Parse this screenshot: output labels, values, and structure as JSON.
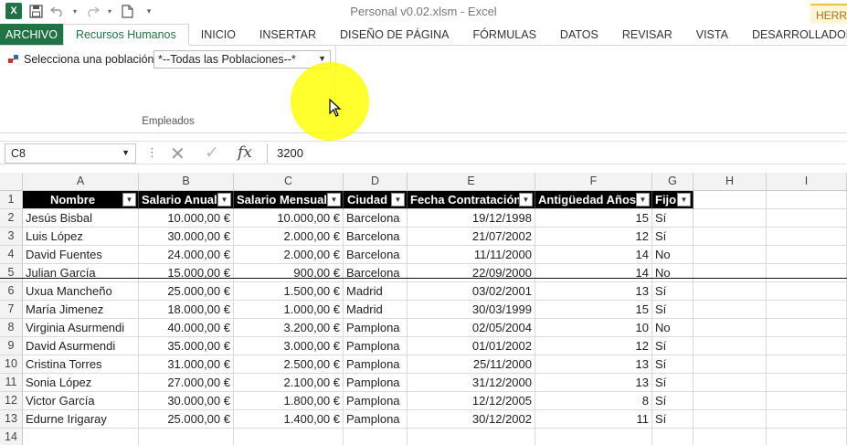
{
  "window": {
    "title": "Personal v0.02.xlsm - Excel",
    "context_tab": "HERRA"
  },
  "qat": {
    "excel_icon": "X",
    "save_icon": "save-icon",
    "undo_icon": "undo-icon",
    "redo_icon": "redo-icon",
    "new_icon": "new-doc-icon",
    "more_icon": "▾"
  },
  "tabs": [
    {
      "label": "ARCHIVO",
      "kind": "file"
    },
    {
      "label": "Recursos Humanos",
      "kind": "active"
    },
    {
      "label": "INICIO",
      "kind": "normal"
    },
    {
      "label": "INSERTAR",
      "kind": "normal"
    },
    {
      "label": "DISEÑO DE PÁGINA",
      "kind": "normal"
    },
    {
      "label": "FÓRMULAS",
      "kind": "normal"
    },
    {
      "label": "DATOS",
      "kind": "normal"
    },
    {
      "label": "REVISAR",
      "kind": "normal"
    },
    {
      "label": "VISTA",
      "kind": "normal"
    },
    {
      "label": "DESARROLLADOR",
      "kind": "normal"
    }
  ],
  "ribbon": {
    "poblacion_label": "Selecciona una población:",
    "poblacion_value": "*--Todas las Poblaciones--*",
    "group_name": "Empleados"
  },
  "formula_bar": {
    "name_box": "C8",
    "value": "3200"
  },
  "columns": [
    "A",
    "B",
    "C",
    "D",
    "E",
    "F",
    "G",
    "H",
    "I"
  ],
  "headers": [
    "Nombre",
    "Salario Anual",
    "Salario Mensual",
    "Ciudad",
    "Fecha Contratación",
    "Antigüedad Años",
    "Fijo"
  ],
  "rows": [
    [
      "Jesús Bisbal",
      "10.000,00 €",
      "10.000,00 €",
      "Barcelona",
      "19/12/1998",
      "15",
      "Sí"
    ],
    [
      "Luis López",
      "30.000,00 €",
      "2.000,00 €",
      "Barcelona",
      "21/07/2002",
      "12",
      "Sí"
    ],
    [
      "David Fuentes",
      "24.000,00 €",
      "2.000,00 €",
      "Barcelona",
      "11/11/2000",
      "14",
      "No"
    ],
    [
      "Julian García",
      "15.000,00 €",
      "900,00 €",
      "Barcelona",
      "22/09/2000",
      "14",
      "No"
    ],
    [
      "Uxua Mancheño",
      "25.000,00 €",
      "1.500,00 €",
      "Madrid",
      "03/02/2001",
      "13",
      "Sí"
    ],
    [
      "María Jimenez",
      "18.000,00 €",
      "1.000,00 €",
      "Madrid",
      "30/03/1999",
      "15",
      "Sí"
    ],
    [
      "Virginia Asurmendi",
      "40.000,00 €",
      "3.200,00 €",
      "Pamplona",
      "02/05/2004",
      "10",
      "No"
    ],
    [
      "David Asurmendi",
      "35.000,00 €",
      "3.000,00 €",
      "Pamplona",
      "01/01/2002",
      "12",
      "Sí"
    ],
    [
      "Cristina Torres",
      "31.000,00 €",
      "2.500,00 €",
      "Pamplona",
      "25/11/2000",
      "13",
      "Sí"
    ],
    [
      "Sonia López",
      "27.000,00 €",
      "2.100,00 €",
      "Pamplona",
      "31/12/2000",
      "13",
      "Sí"
    ],
    [
      "Victor García",
      "30.000,00 €",
      "1.800,00 €",
      "Pamplona",
      "12/12/2005",
      "8",
      "Sí"
    ],
    [
      "Edurne Irigaray",
      "25.000,00 €",
      "1.400,00 €",
      "Pamplona",
      "30/12/2002",
      "11",
      "Sí"
    ]
  ],
  "row_numbers": [
    "1",
    "2",
    "3",
    "4",
    "5",
    "6",
    "7",
    "8",
    "9",
    "10",
    "11",
    "12",
    "13",
    "14"
  ],
  "colors": {
    "excel_green": "#217346",
    "header_black": "#000000",
    "highlight_yellow": "#ffff00"
  }
}
